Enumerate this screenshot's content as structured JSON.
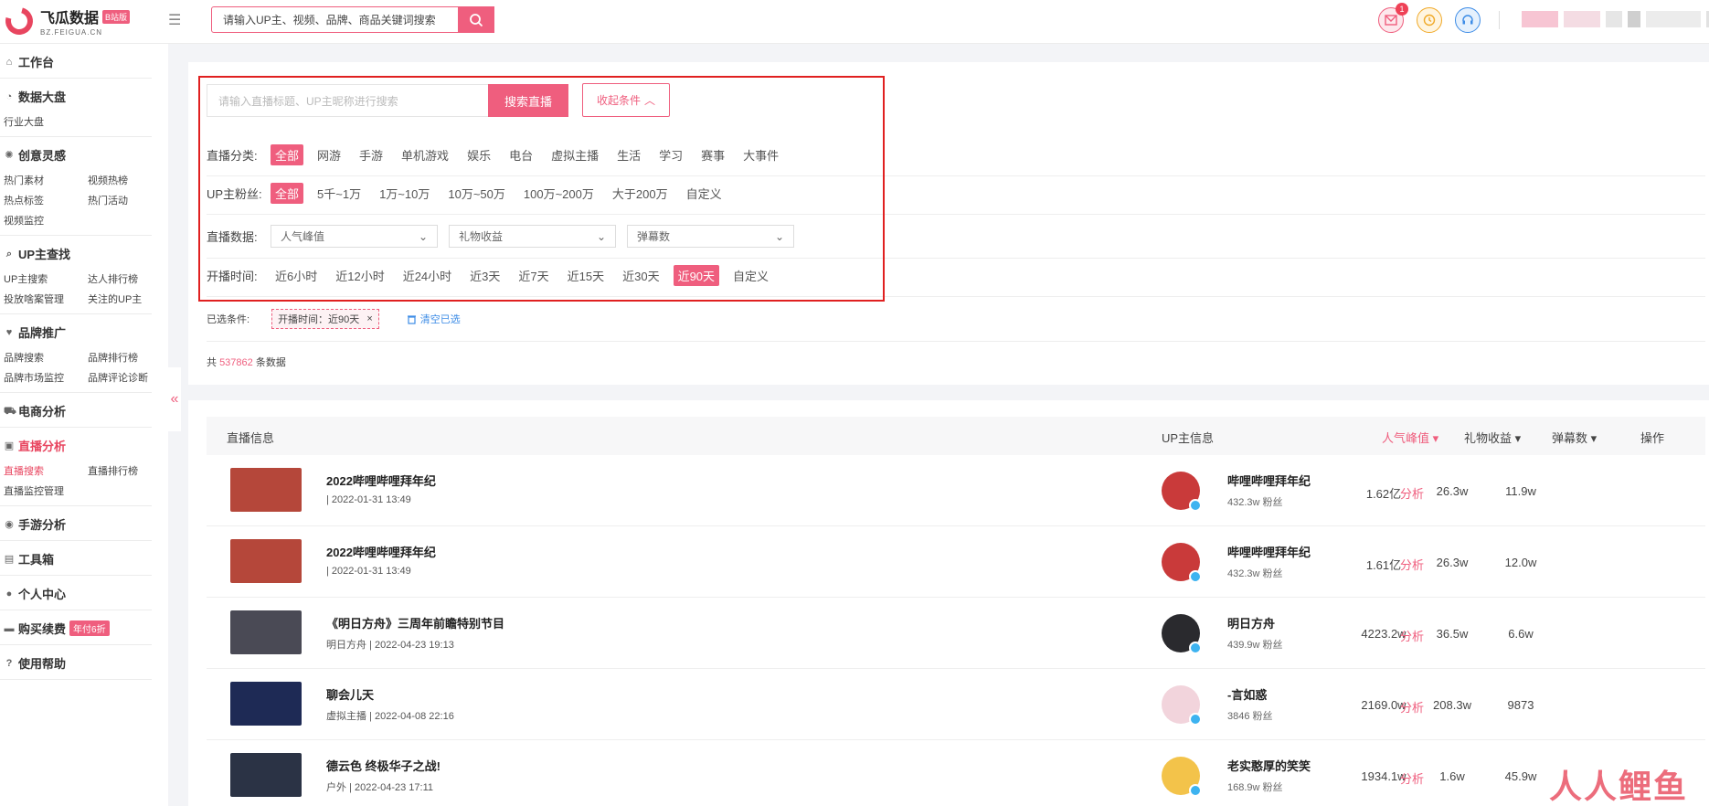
{
  "brand": {
    "name": "飞瓜数据",
    "badge": "B站版",
    "domain": "BZ.FEIGUA.CN"
  },
  "top_search": {
    "placeholder": "请输入UP主、视频、品牌、商品关键词搜索"
  },
  "header": {
    "notification_count": "1"
  },
  "sidebar": {
    "groups": [
      {
        "label": "工作台",
        "icon": "home-icon",
        "items": []
      },
      {
        "label": "数据大盘",
        "icon": "pie-chart-icon",
        "items": [
          "行业大盘"
        ]
      },
      {
        "label": "创意灵感",
        "icon": "bulb-icon",
        "items": [
          "热门素材",
          "视频热榜",
          "热点标签",
          "热门活动",
          "视频监控"
        ]
      },
      {
        "label": "UP主查找",
        "icon": "search-icon",
        "items": [
          "UP主搜索",
          "达人排行榜",
          "投放啥案管理",
          "关注的UP主"
        ]
      },
      {
        "label": "品牌推广",
        "icon": "heart-icon",
        "items": [
          "品牌搜索",
          "品牌排行榜",
          "品牌市场监控",
          "品牌评论诊断"
        ]
      },
      {
        "label": "电商分析",
        "icon": "cart-icon",
        "items": []
      },
      {
        "label": "直播分析",
        "icon": "live-icon",
        "items": [
          "直播搜索",
          "直播排行榜",
          "直播监控管理"
        ]
      },
      {
        "label": "手游分析",
        "icon": "gamepad-icon",
        "items": []
      },
      {
        "label": "工具箱",
        "icon": "toolbox-icon",
        "items": []
      },
      {
        "label": "个人中心",
        "icon": "user-icon",
        "items": []
      },
      {
        "label": "购买续费",
        "icon": "wallet-icon",
        "items": [],
        "promo": "年付6折"
      },
      {
        "label": "使用帮助",
        "icon": "help-icon",
        "items": []
      }
    ]
  },
  "filters": {
    "search_placeholder": "请输入直播标题、UP主昵称进行搜索",
    "search_button": "搜索直播",
    "collapse_button": "收起条件",
    "category": {
      "label": "直播分类:",
      "options": [
        "全部",
        "网游",
        "手游",
        "单机游戏",
        "娱乐",
        "电台",
        "虚拟主播",
        "生活",
        "学习",
        "赛事",
        "大事件"
      ],
      "selected": 0
    },
    "fans": {
      "label": "UP主粉丝:",
      "options": [
        "全部",
        "5千~1万",
        "1万~10万",
        "10万~50万",
        "100万~200万",
        "大于200万",
        "自定义"
      ],
      "selected": 0
    },
    "data": {
      "label": "直播数据:",
      "dropdowns": [
        "人气峰值",
        "礼物收益",
        "弹幕数"
      ]
    },
    "time": {
      "label": "开播时间:",
      "options": [
        "近6小时",
        "近12小时",
        "近24小时",
        "近3天",
        "近7天",
        "近15天",
        "近30天",
        "近90天",
        "自定义"
      ],
      "selected": 7
    },
    "chosen_label": "已选条件:",
    "chosen_chip": "开播时间：近90天",
    "clear_label": "清空已选",
    "count_prefix": "共",
    "count_value": "537862",
    "count_suffix": "条数据"
  },
  "table": {
    "headers": {
      "live": "直播信息",
      "up": "UP主信息",
      "peak": "人气峰值",
      "gift": "礼物收益",
      "danmaku": "弹幕数",
      "action": "操作"
    },
    "rows": [
      {
        "title": "2022哔哩哔哩拜年纪",
        "sub": "| 2022-01-31 13:49",
        "up": "哔哩哔哩拜年纪",
        "fans": "432.3w 粉丝",
        "peak": "1.62亿",
        "gift": "26.3w",
        "danmaku": "11.9w",
        "action": "分析",
        "thumb": "#b5473a",
        "avatar": "#c93a3a"
      },
      {
        "title": "2022哔哩哔哩拜年纪",
        "sub": "| 2022-01-31 13:49",
        "up": "哔哩哔哩拜年纪",
        "fans": "432.3w 粉丝",
        "peak": "1.61亿",
        "gift": "26.3w",
        "danmaku": "12.0w",
        "action": "分析",
        "thumb": "#b5473a",
        "avatar": "#c93a3a"
      },
      {
        "title": "《明日方舟》三周年前瞻特别节目",
        "sub": "明日方舟 | 2022-04-23 19:13",
        "up": "明日方舟",
        "fans": "439.9w 粉丝",
        "peak": "4223.2w",
        "gift": "36.5w",
        "danmaku": "6.6w",
        "action": "分析",
        "thumb": "#4a4a55",
        "avatar": "#2a2a2e"
      },
      {
        "title": "聊会儿天",
        "sub": "虚拟主播 | 2022-04-08 22:16",
        "up": "-言如惑",
        "fans": "3846 粉丝",
        "peak": "2169.0w",
        "gift": "208.3w",
        "danmaku": "9873",
        "action": "分析",
        "thumb": "#1e2a55",
        "avatar": "#f2d4dc"
      },
      {
        "title": "德云色 终极华子之战!",
        "sub": "户外 | 2022-04-23 17:11",
        "up": "老实憨厚的笑笑",
        "fans": "168.9w 粉丝",
        "peak": "1934.1w",
        "gift": "1.6w",
        "danmaku": "45.9w",
        "action": "分析",
        "thumb": "#2b3345",
        "avatar": "#f3c34a"
      }
    ]
  },
  "watermark": "人人鲤鱼"
}
